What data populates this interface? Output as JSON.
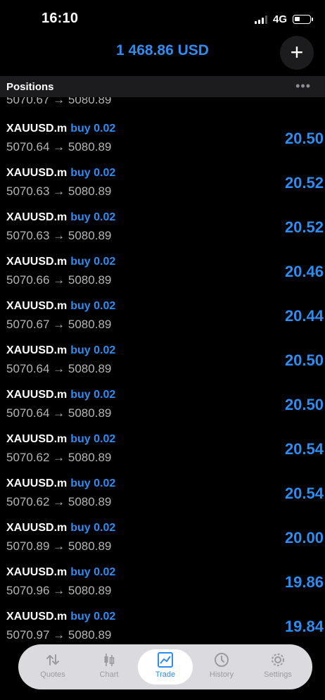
{
  "status_bar": {
    "time": "16:10",
    "network": "4G",
    "battery_percent": 35
  },
  "account": {
    "balance": "1 468.86 USD"
  },
  "positions_header": {
    "title": "Positions"
  },
  "partial_top_prices": "5070.67 → 5080.89",
  "positions": [
    {
      "symbol": "XAUUSD.m",
      "side": "buy 0.02",
      "prices": "5070.64 → 5080.89",
      "profit": "20.50"
    },
    {
      "symbol": "XAUUSD.m",
      "side": "buy 0.02",
      "prices": "5070.63 → 5080.89",
      "profit": "20.52"
    },
    {
      "symbol": "XAUUSD.m",
      "side": "buy 0.02",
      "prices": "5070.63 → 5080.89",
      "profit": "20.52"
    },
    {
      "symbol": "XAUUSD.m",
      "side": "buy 0.02",
      "prices": "5070.66 → 5080.89",
      "profit": "20.46"
    },
    {
      "symbol": "XAUUSD.m",
      "side": "buy 0.02",
      "prices": "5070.67 → 5080.89",
      "profit": "20.44"
    },
    {
      "symbol": "XAUUSD.m",
      "side": "buy 0.02",
      "prices": "5070.64 → 5080.89",
      "profit": "20.50"
    },
    {
      "symbol": "XAUUSD.m",
      "side": "buy 0.02",
      "prices": "5070.64 → 5080.89",
      "profit": "20.50"
    },
    {
      "symbol": "XAUUSD.m",
      "side": "buy 0.02",
      "prices": "5070.62 → 5080.89",
      "profit": "20.54"
    },
    {
      "symbol": "XAUUSD.m",
      "side": "buy 0.02",
      "prices": "5070.62 → 5080.89",
      "profit": "20.54"
    },
    {
      "symbol": "XAUUSD.m",
      "side": "buy 0.02",
      "prices": "5070.89 → 5080.89",
      "profit": "20.00"
    },
    {
      "symbol": "XAUUSD.m",
      "side": "buy 0.02",
      "prices": "5070.96 → 5080.89",
      "profit": "19.86"
    },
    {
      "symbol": "XAUUSD.m",
      "side": "buy 0.02",
      "prices": "5070.97 → 5080.89",
      "profit": "19.84"
    }
  ],
  "tabs": [
    {
      "label": "Quotes",
      "icon": "quotes-icon"
    },
    {
      "label": "Chart",
      "icon": "chart-icon"
    },
    {
      "label": "Trade",
      "icon": "trade-icon",
      "active": true
    },
    {
      "label": "History",
      "icon": "history-icon"
    },
    {
      "label": "Settings",
      "icon": "settings-icon"
    }
  ],
  "colors": {
    "accent": "#2f8cf0",
    "background": "#000000"
  }
}
